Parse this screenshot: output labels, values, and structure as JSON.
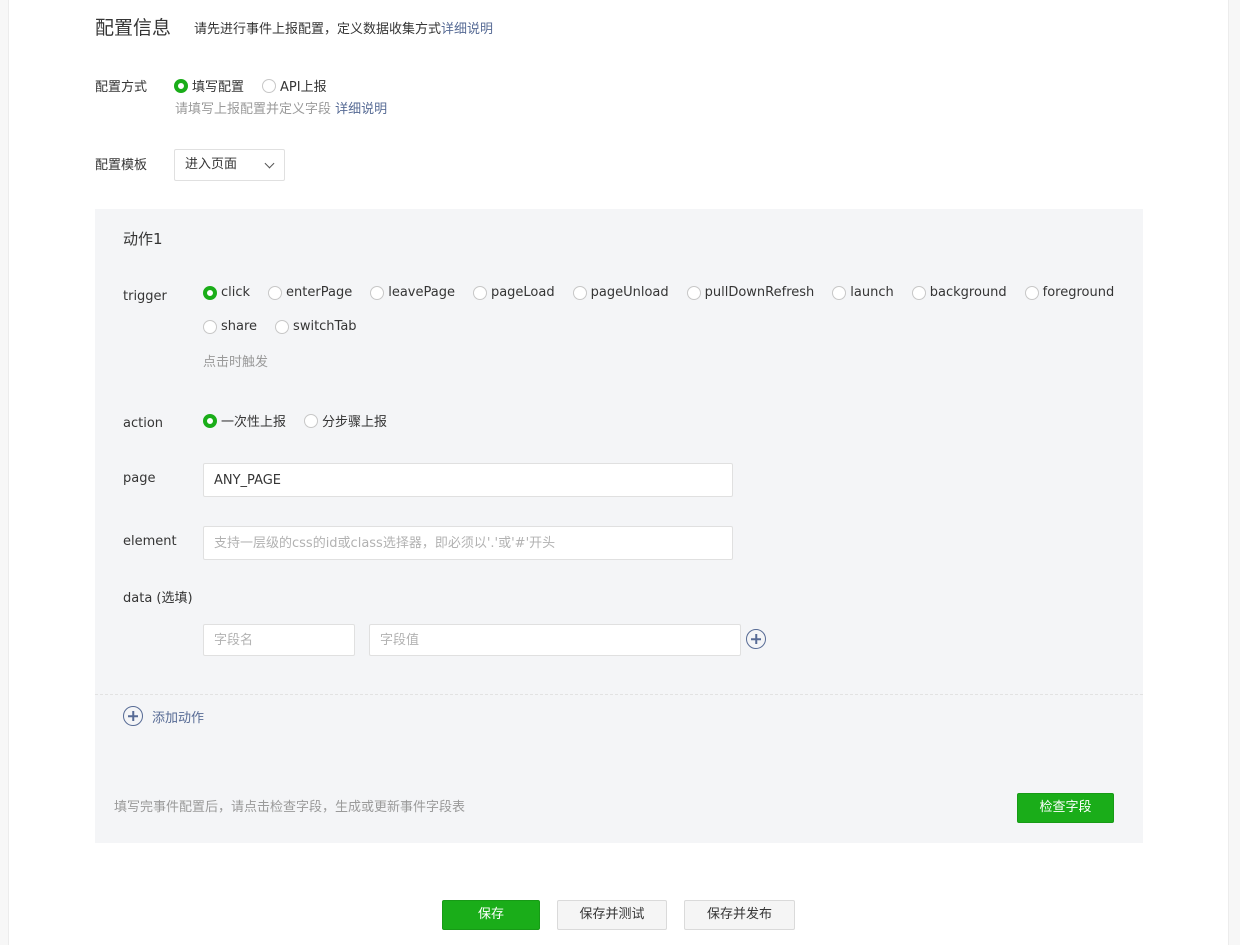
{
  "header": {
    "title": "配置信息",
    "tip": "请先进行事件上报配置，定义数据收集方式",
    "tip_link": "详细说明"
  },
  "config_mode": {
    "label": "配置方式",
    "options": [
      {
        "label": "填写配置",
        "selected": true
      },
      {
        "label": "API上报",
        "selected": false
      }
    ],
    "hint": "请填写上报配置并定义字段",
    "hint_link": "详细说明"
  },
  "template": {
    "label": "配置模板",
    "selected": "进入页面"
  },
  "action": {
    "title": "动作1",
    "trigger": {
      "label": "trigger",
      "options_row1": [
        {
          "label": "click",
          "selected": true
        },
        {
          "label": "enterPage",
          "selected": false
        },
        {
          "label": "leavePage",
          "selected": false
        },
        {
          "label": "pageLoad",
          "selected": false
        },
        {
          "label": "pageUnload",
          "selected": false
        },
        {
          "label": "pullDownRefresh",
          "selected": false
        },
        {
          "label": "launch",
          "selected": false
        },
        {
          "label": "background",
          "selected": false
        },
        {
          "label": "foreground",
          "selected": false
        }
      ],
      "options_row2": [
        {
          "label": "share",
          "selected": false
        },
        {
          "label": "switchTab",
          "selected": false
        }
      ],
      "hint": "点击时触发"
    },
    "action_type": {
      "label": "action",
      "options": [
        {
          "label": "一次性上报",
          "selected": true
        },
        {
          "label": "分步骤上报",
          "selected": false
        }
      ]
    },
    "page": {
      "label": "page",
      "value": "ANY_PAGE"
    },
    "element": {
      "label": "element",
      "placeholder": "支持一层级的css的id或class选择器，即必须以'.'或'#'开头"
    },
    "data": {
      "label": "data (选填)",
      "name_placeholder": "字段名",
      "value_placeholder": "字段值"
    }
  },
  "add_action_label": "添加动作",
  "check": {
    "hint": "填写完事件配置后，请点击检查字段，生成或更新事件字段表",
    "button": "检查字段"
  },
  "footer": {
    "save": "保存",
    "save_test": "保存并测试",
    "save_publish": "保存并发布"
  },
  "colors": {
    "primary": "#1aad19",
    "link": "#576b95"
  }
}
